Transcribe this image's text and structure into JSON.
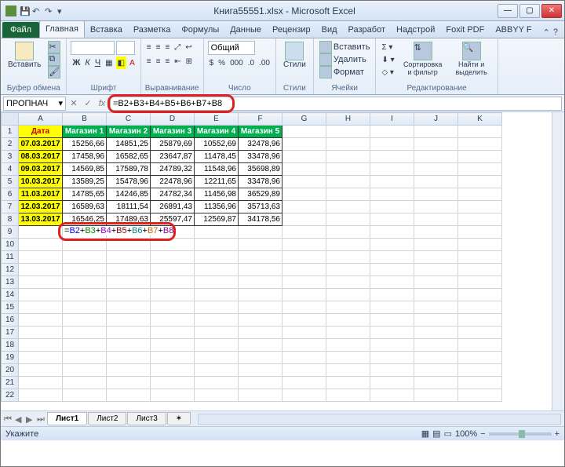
{
  "title": "Книга55551.xlsx - Microsoft Excel",
  "tabs": {
    "file": "Файл",
    "items": [
      "Главная",
      "Вставка",
      "Разметка",
      "Формулы",
      "Данные",
      "Рецензир",
      "Вид",
      "Разработ",
      "Надстрой",
      "Foxit PDF",
      "ABBYY F"
    ]
  },
  "ribbon": {
    "paste": "Вставить",
    "group_clipboard": "Буфер обмена",
    "font_name": "",
    "font_size": "",
    "group_font": "Шрифт",
    "group_align": "Выравнивание",
    "format_general": "Общий",
    "group_number": "Число",
    "styles": "Стили",
    "group_styles": "Стили",
    "insert": "Вставить",
    "delete": "Удалить",
    "format": "Формат",
    "group_cells": "Ячейки",
    "sort": "Сортировка и фильтр",
    "find": "Найти и выделить",
    "group_edit": "Редактирование"
  },
  "namebox": "ПРОПНАЧ",
  "formula": "=B2+B3+B4+B5+B6+B7+B8",
  "columns": [
    "A",
    "B",
    "C",
    "D",
    "E",
    "F",
    "G",
    "H",
    "I",
    "J",
    "K"
  ],
  "headers": [
    "Дата",
    "Магазин 1",
    "Магазин 2",
    "Магазин 3",
    "Магазин 4",
    "Магазин 5"
  ],
  "rows": [
    {
      "d": "07.03.2017",
      "v": [
        "15256,66",
        "14851,25",
        "25879,69",
        "10552,69",
        "32478,96"
      ]
    },
    {
      "d": "08.03.2017",
      "v": [
        "17458,96",
        "16582,65",
        "23647,87",
        "11478,45",
        "33478,96"
      ]
    },
    {
      "d": "09.03.2017",
      "v": [
        "14569,85",
        "17589,78",
        "24789,32",
        "11548,96",
        "35698,89"
      ]
    },
    {
      "d": "10.03.2017",
      "v": [
        "13589,25",
        "15478,96",
        "22478,96",
        "12211,65",
        "33478,96"
      ]
    },
    {
      "d": "11.03.2017",
      "v": [
        "14785,65",
        "14246,85",
        "24782,34",
        "11456,98",
        "36529,89"
      ]
    },
    {
      "d": "12.03.2017",
      "v": [
        "16589,63",
        "18111,54",
        "26891,43",
        "11356,96",
        "35713,63"
      ]
    },
    {
      "d": "13.03.2017",
      "v": [
        "16546,25",
        "17489,63",
        "25597,47",
        "12569,87",
        "34178,56"
      ]
    }
  ],
  "edit_parts": [
    "=",
    "B2",
    "+",
    "B3",
    "+",
    "B4",
    "+",
    "B5",
    "+",
    "B6",
    "+",
    "B7",
    "+",
    "B8"
  ],
  "sheets": [
    "Лист1",
    "Лист2",
    "Лист3"
  ],
  "status": {
    "label": "Укажите",
    "zoom": "100%"
  }
}
